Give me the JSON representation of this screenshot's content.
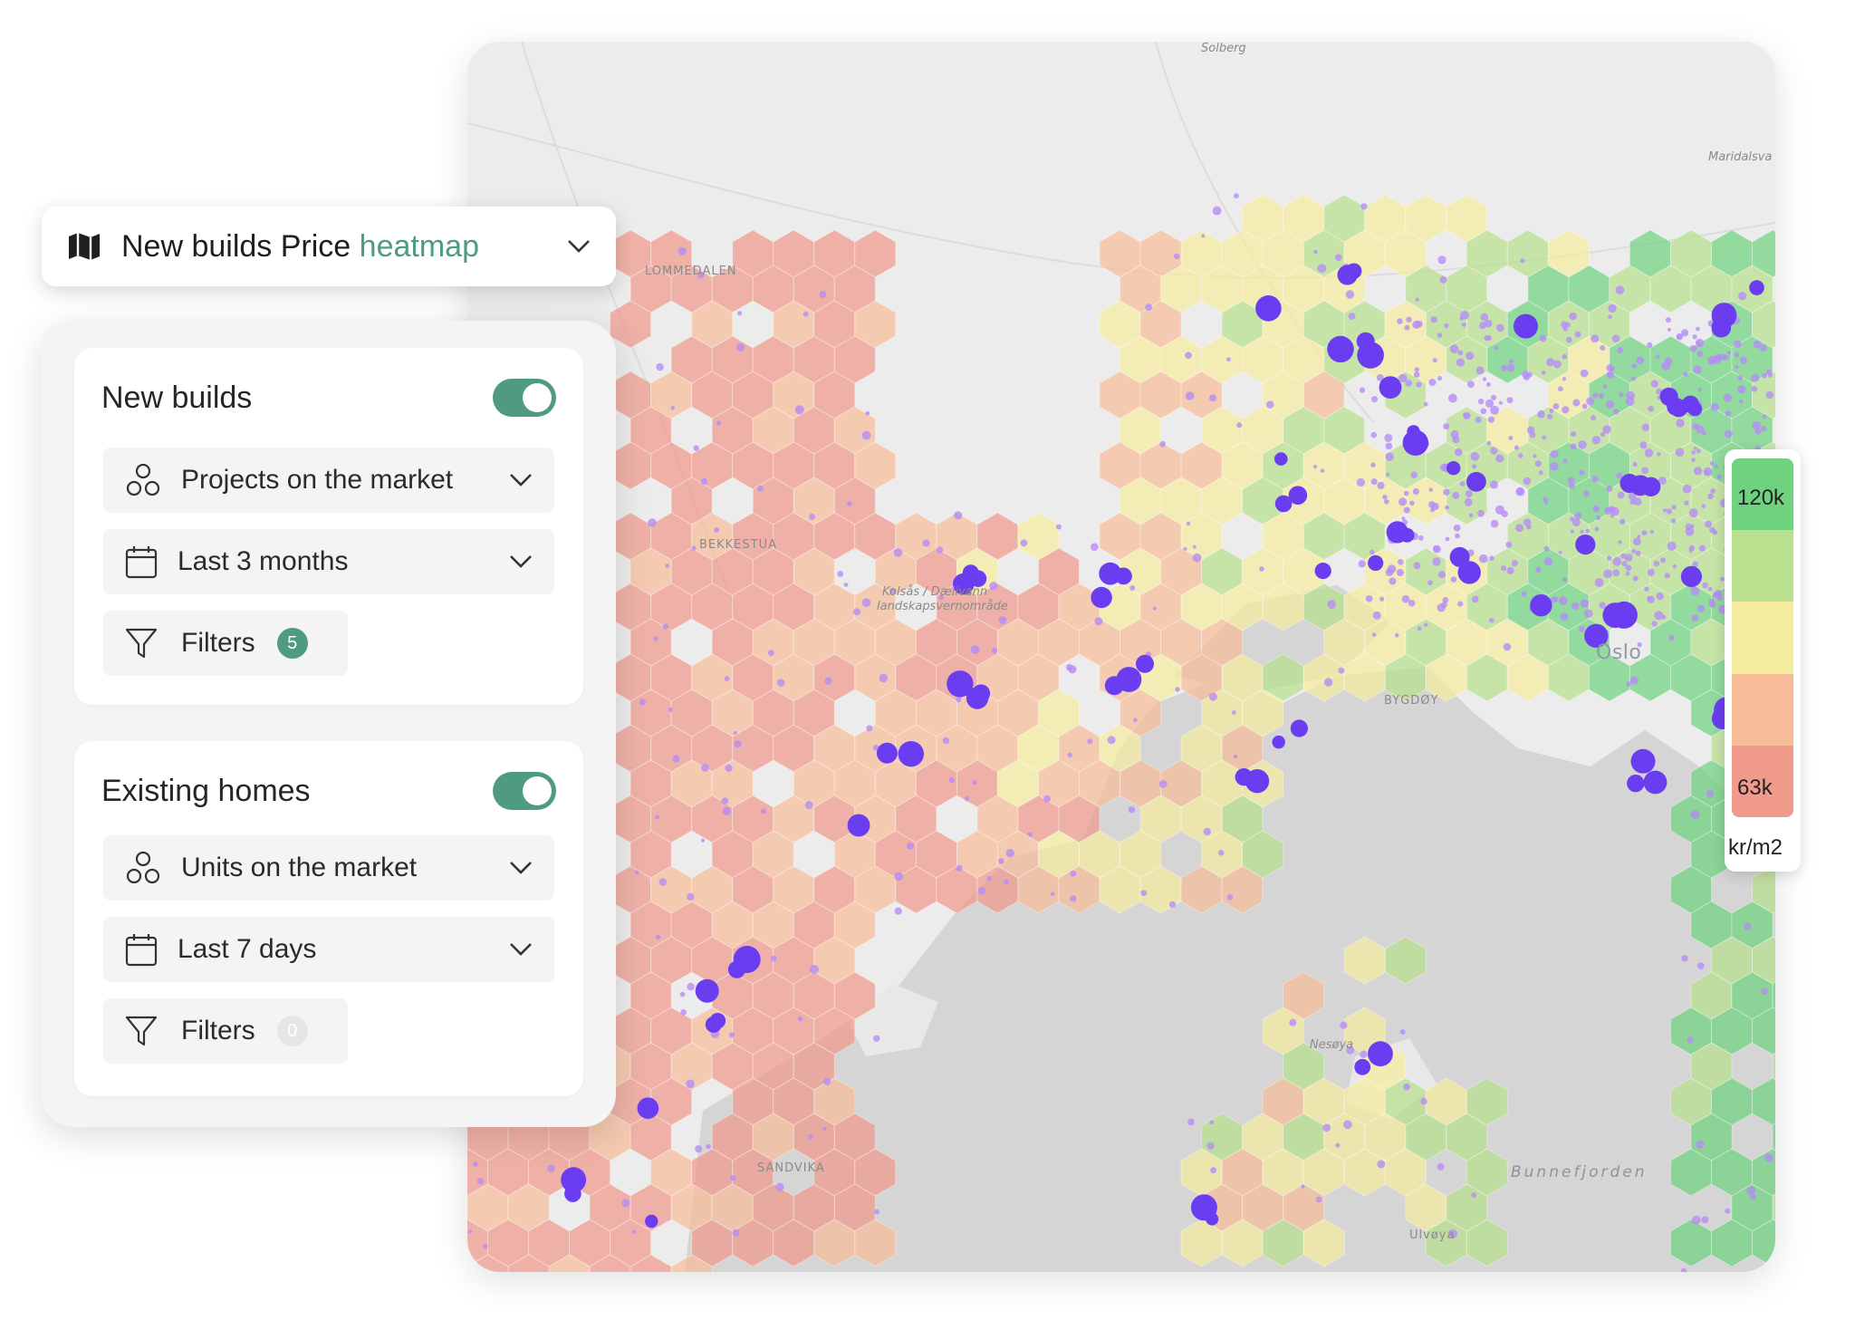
{
  "title_card": {
    "icon": "map-icon",
    "title_prefix": "New builds Price",
    "title_accent": "heatmap",
    "accent_color": "#4f9a83"
  },
  "new_builds": {
    "title": "New builds",
    "enabled": true,
    "type_label": "Projects on the market",
    "period_label": "Last 3 months",
    "filters_label": "Filters",
    "filters_count": "5"
  },
  "existing_homes": {
    "title": "Existing homes",
    "enabled": true,
    "type_label": "Units on the market",
    "period_label": "Last 7 days",
    "filters_label": "Filters",
    "filters_count": "0"
  },
  "legend": {
    "max_label": "120k",
    "min_label": "63k",
    "unit": "kr/m2",
    "colors": [
      "#6fd27f",
      "#b8e08e",
      "#f6eca0",
      "#f6bd98",
      "#f09a8c"
    ]
  },
  "map": {
    "labels": {
      "lommedalen": "LOMMEDALEN",
      "bekkestua": "BEKKESTUA",
      "kolsas": "Kolsås / Dælivann",
      "kolsas2": "landskapsvernområde",
      "bygdoy": "BYGDØY",
      "oslo": "Oslo",
      "maridalsvannet": "Maridalsva",
      "bunnefjorden": "Bunnefjorden",
      "solberg": "Solberg",
      "nesoya": "Nesøya",
      "ulvoya": "Ulvøya",
      "sandvika": "SANDVIKA"
    },
    "colors": {
      "green": "#6fd27f",
      "lightgreen": "#b8e08e",
      "yellow": "#f6eca0",
      "peach": "#f6bd98",
      "salmon": "#f09a8c",
      "marker": "#6a3df0",
      "dot": "#b58cf7"
    }
  }
}
